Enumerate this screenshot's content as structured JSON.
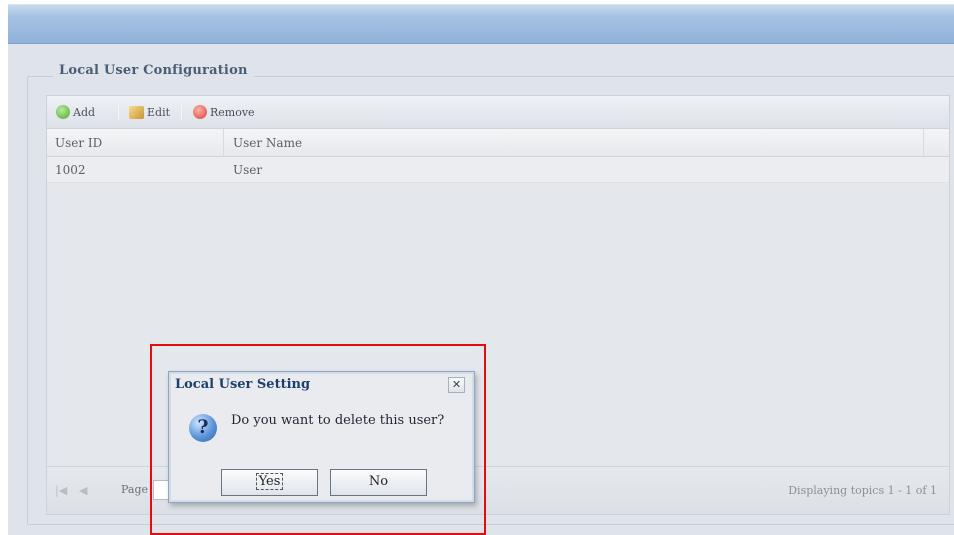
{
  "panel": {
    "legend": "Local User Configuration"
  },
  "toolbar": {
    "add_label": "Add",
    "edit_label": "Edit",
    "remove_label": "Remove",
    "add_icon": "add-icon",
    "edit_icon": "edit-icon",
    "remove_icon": "remove-icon"
  },
  "table": {
    "columns": [
      "User ID",
      "User Name"
    ],
    "rows": [
      {
        "user_id": "1002",
        "user_name": "User"
      }
    ]
  },
  "pager": {
    "page_label": "Page",
    "summary": "Displaying topics 1 - 1 of 1"
  },
  "dialog": {
    "title": "Local User Setting",
    "close_glyph": "✕",
    "icon_glyph": "?",
    "message": "Do you want to delete this user?",
    "yes_label": "Yes",
    "no_label": "No"
  },
  "colors": {
    "highlight_border": "#e30d0d",
    "title_bar": "#8fb2d8",
    "dialog_title": "#1d3f6e"
  }
}
